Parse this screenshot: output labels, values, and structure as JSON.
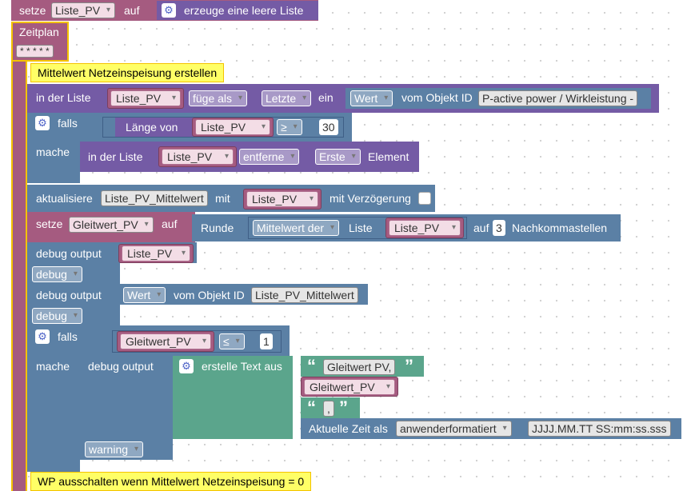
{
  "top_set": {
    "setze": "setze",
    "var": "Liste_PV",
    "auf": "auf",
    "create": "erzeuge eine leere Liste"
  },
  "schedule": {
    "label": "Zeitplan",
    "cron": "* * * * *"
  },
  "comments": {
    "c1": "Mittelwert Netzeinspeisung erstellen",
    "c2": "WP ausschalten wenn Mittelwert Netzeinspeisung = 0"
  },
  "list_insert": {
    "in_der_liste": "in der Liste",
    "var": "Liste_PV",
    "mode": "füge als",
    "pos": "Letzte",
    "ein": "ein",
    "wert": "Wert",
    "vom": "vom Objekt ID",
    "objid": "P-active power / Wirkleistung -"
  },
  "if1": {
    "falls": "falls",
    "mache": "mache",
    "laenge": "Länge von",
    "var": "Liste_PV",
    "op": "≥",
    "num": "30"
  },
  "list_remove": {
    "in_der_liste": "in der Liste",
    "var": "Liste_PV",
    "mode": "entferne",
    "pos": "Erste",
    "element": "Element"
  },
  "update": {
    "label": "aktualisiere",
    "target": "Liste_PV_Mittelwert",
    "mit": "mit",
    "var": "Liste_PV",
    "delay": "mit Verzögerung"
  },
  "set_gleit": {
    "setze": "setze",
    "var": "Gleitwert_PV",
    "auf": "auf",
    "runde": "Runde",
    "mittel": "Mittelwert der",
    "liste": "Liste",
    "listvar": "Liste_PV",
    "auf2": "auf",
    "num": "3",
    "nach": "Nachkommastellen"
  },
  "debug1": {
    "label": "debug output",
    "var": "Liste_PV",
    "level": "debug"
  },
  "debug2": {
    "label": "debug output",
    "wert": "Wert",
    "vom": "vom Objekt ID",
    "objid": "Liste_PV_Mittelwert",
    "level": "debug"
  },
  "if2": {
    "falls": "falls",
    "mache": "mache",
    "var": "Gleitwert_PV",
    "op": "≤",
    "num": "1"
  },
  "debug3": {
    "label": "debug output",
    "create": "erstelle Text aus",
    "text1": "Gleitwert PV,",
    "var": "Gleitwert_PV",
    "text2": ",",
    "zeit": "Aktuelle Zeit als",
    "format": "anwenderformatiert",
    "pattern": "JJJJ.MM.TT SS:mm:ss.sss",
    "level": "warning"
  },
  "colors": {
    "schedule": "#a55b80",
    "comment": "#ffff66",
    "logic": "#5b80a5",
    "list": "#745ba5",
    "text": "#5ba58c",
    "var": "#a55b80"
  }
}
